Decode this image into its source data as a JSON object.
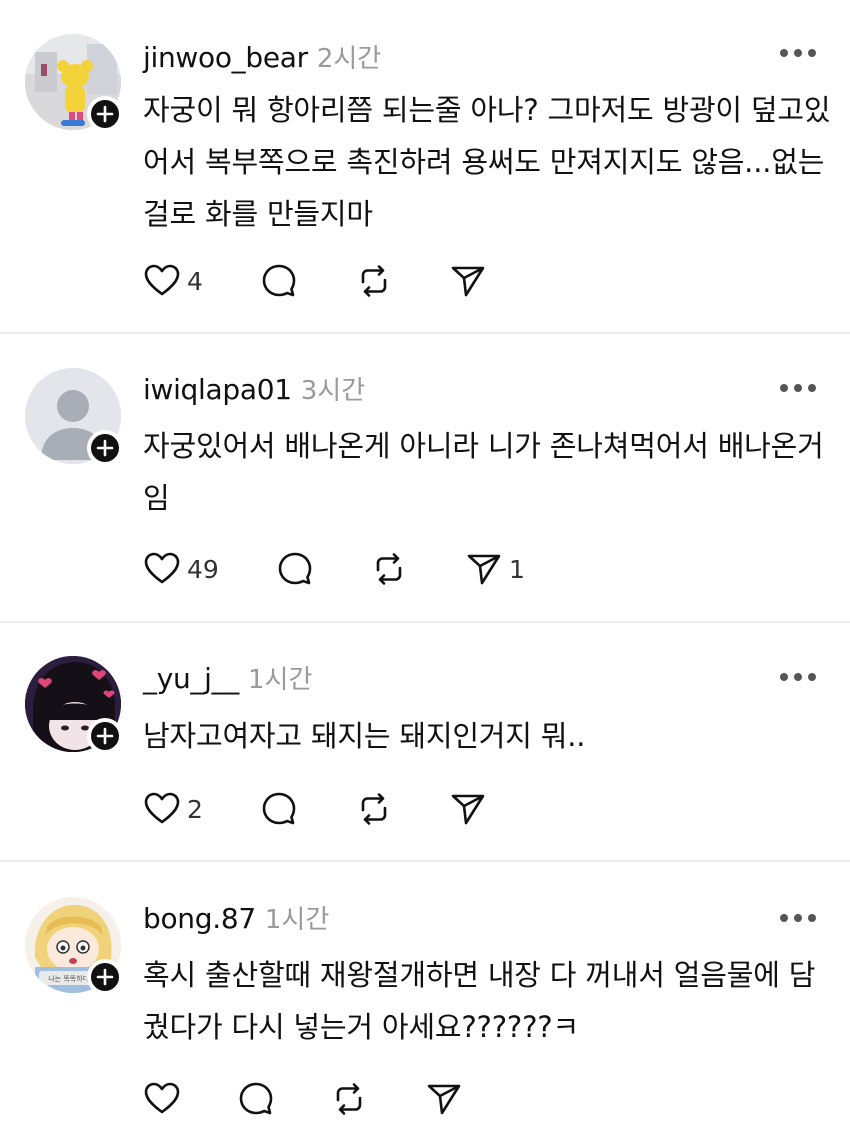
{
  "posts": [
    {
      "username": "jinwoo_bear",
      "time": "2시간",
      "text": "자궁이 뭐 항아리쯤 되는줄 아나? 그마저도 방광이 덮고있어서 복부쪽으로 촉진하려 용써도 만져지지도 않음...없는걸로 화를 만들지마",
      "likes": "4",
      "shares": ""
    },
    {
      "username": "iwiqlapa01",
      "time": "3시간",
      "text": "자궁있어서 배나온게 아니라 니가 존나쳐먹어서 배나온거임",
      "likes": "49",
      "shares": "1"
    },
    {
      "username": "_yu_j__",
      "time": "1시간",
      "text": "남자고여자고 돼지는 돼지인거지 뭐..",
      "likes": "2",
      "shares": ""
    },
    {
      "username": "bong.87",
      "time": "1시간",
      "text": "혹시 출산할때 재왕절개하면 내장 다 꺼내서 얼음물에 담궜다가 다시 넣는거 아세요??????ㅋ",
      "likes": "",
      "shares": "",
      "avatar_caption": "나는 똑똑하다 바"
    }
  ],
  "colors": {
    "text": "#111111",
    "muted": "#9a9a9a",
    "divider": "#ececec",
    "badge": "#111111"
  }
}
